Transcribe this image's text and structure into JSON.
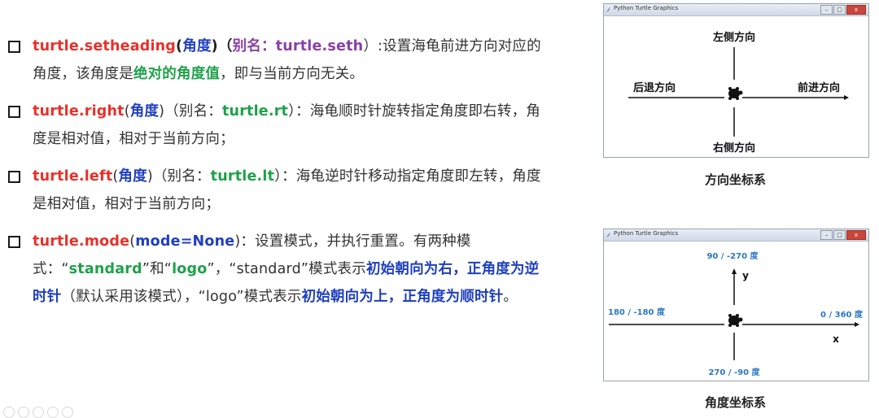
{
  "bullets": {
    "b1": {
      "fn": "turtle.setheading",
      "p1": "(",
      "arg": "角度",
      "p2": ")（",
      "alias": "别名：turtle.seth",
      "p3": "）:设置海龟前进方向对应的角度，该角度是",
      "em": "绝对的角度值",
      "p4": "，即与当前方向无关。"
    },
    "b2": {
      "fn": "turtle.right",
      "p1": "(",
      "arg": "角度",
      "p2": ")（别名：",
      "alias": "turtle.rt",
      "p3": "）：海龟顺时针旋转指定角度即右转，角度是相对值，相对于当前方向；"
    },
    "b3": {
      "fn": "turtle.left",
      "p1": "(",
      "arg": "角度",
      "p2": ")（别名：",
      "alias": "turtle.lt",
      "p3": "）：海龟逆时针移动指定角度即左转，角度是相对值，相对于当前方向；"
    },
    "b4": {
      "fn": "turtle.mode",
      "p1": "(",
      "arg": "mode=None",
      "p2": ")：设置模式，并执行重置。有两种模式：“",
      "m1": "standard",
      "p3": "”和“",
      "m2": "logo",
      "p4": "”，“standard”模式表示",
      "em1": "初始朝向为右，正角度为逆时针",
      "p5": "（默认采用该模式），“logo”模式表示",
      "em2": "初始朝向为上，正角度为顺时针",
      "p6": "。"
    }
  },
  "window1": {
    "title": "Python Turtle Graphics",
    "labels": {
      "up": "左侧方向",
      "left": "后退方向",
      "right": "前进方向",
      "down": "右侧方向"
    },
    "caption": "方向坐标系"
  },
  "window2": {
    "title": "Python Turtle Graphics",
    "labels": {
      "up": "90 / -270 度",
      "left": "180 / -180 度",
      "right": "0 / 360 度",
      "down": "270 / -90 度",
      "y": "y",
      "x": "x"
    },
    "caption": "角度坐标系"
  },
  "colors": {
    "function": "#e8312a",
    "argument": "#1f3fbf",
    "alias": "#8a3fa8",
    "highlight": "#1fa14a",
    "axis_label_blue": "#2b78c2"
  }
}
